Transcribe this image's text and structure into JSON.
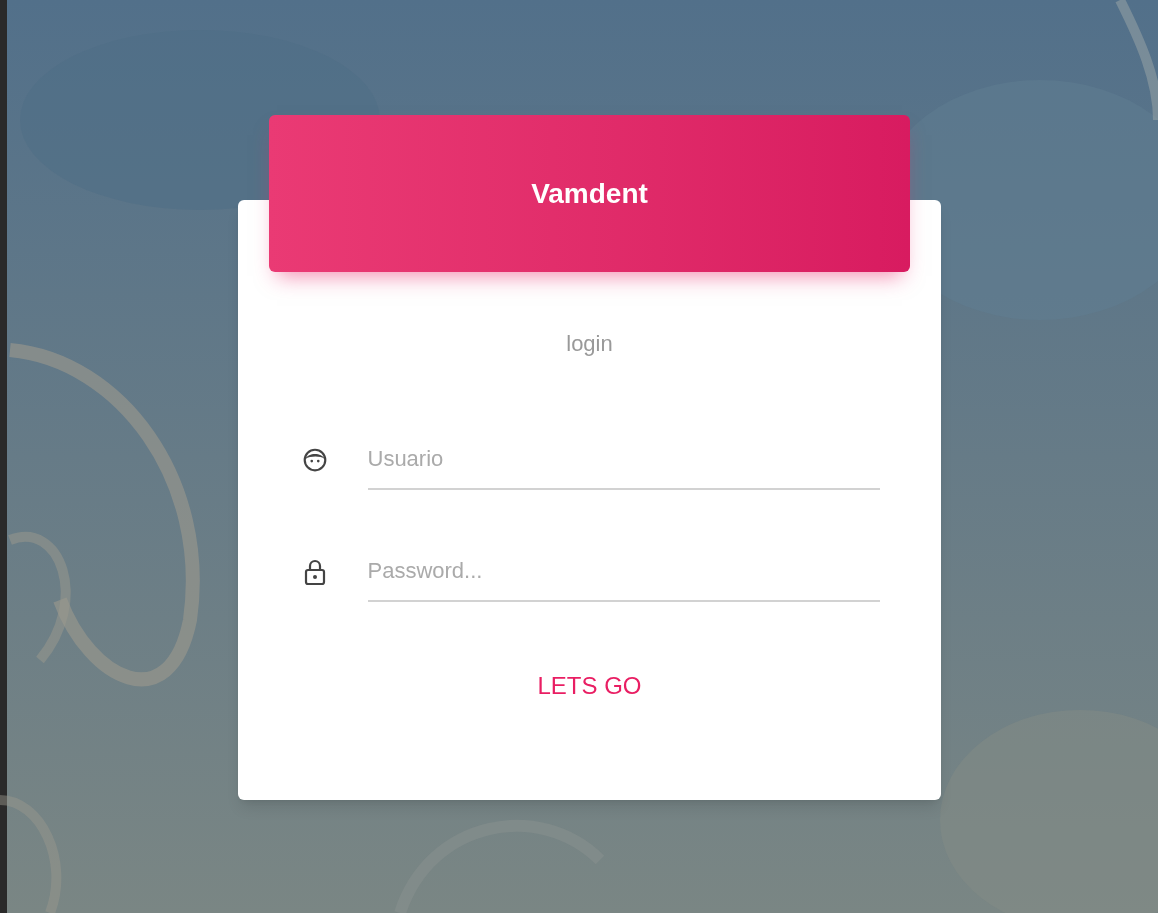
{
  "header": {
    "title": "Vamdent"
  },
  "subtitle": "login",
  "fields": [
    {
      "kind": "user",
      "placeholder": "Usuario"
    },
    {
      "kind": "password",
      "placeholder": "Password..."
    }
  ],
  "submit": {
    "label": "LETS GO"
  }
}
